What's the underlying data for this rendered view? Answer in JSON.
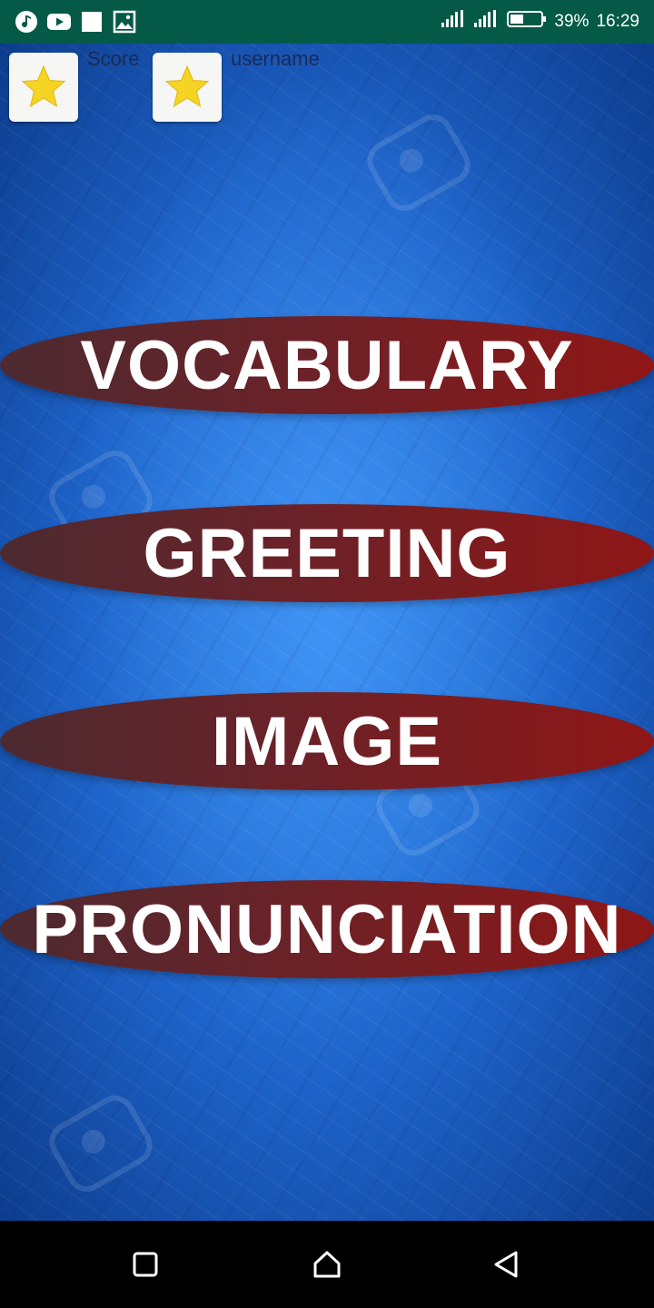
{
  "status_bar": {
    "battery_percent": "39%",
    "time": "16:29",
    "icons": [
      "music-icon",
      "youtube-icon",
      "white-square-icon",
      "gallery-icon",
      "signal-icon",
      "signal-icon",
      "battery-icon"
    ]
  },
  "header": {
    "score_label": "Score",
    "username_label": "username",
    "star_color": "#f5d423"
  },
  "menu": {
    "items": [
      {
        "label": "VOCABULARY"
      },
      {
        "label": "GREETING"
      },
      {
        "label": "IMAGE"
      },
      {
        "label": "PRONUNCIATION"
      }
    ]
  },
  "nav_bar": {
    "icons": [
      "recent-apps-icon",
      "home-icon",
      "back-icon"
    ]
  },
  "colors": {
    "status_bar": "#045a47",
    "background_blue": "#1d62c8",
    "button_dark": "#4c2a30",
    "button_red": "#8f1616"
  }
}
